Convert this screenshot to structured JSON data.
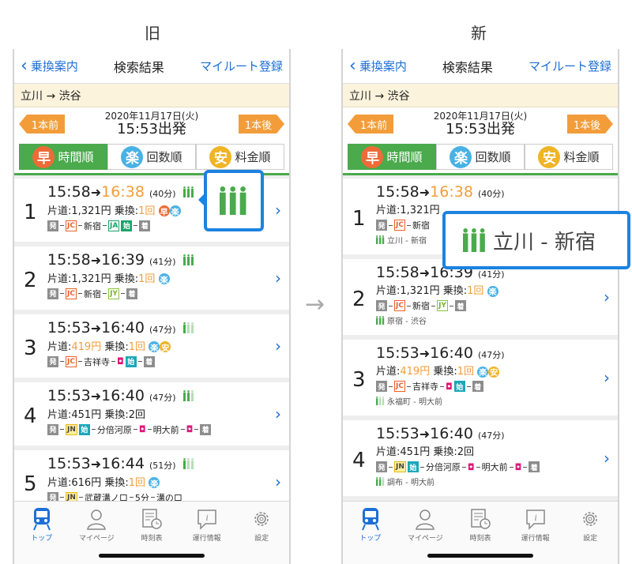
{
  "labels": {
    "old": "旧",
    "new": "新"
  },
  "nav": {
    "back": "乗換案内",
    "title": "検索結果",
    "right": "マイルート登録"
  },
  "route": "立川 → 渋谷",
  "date": {
    "prev": "1本前",
    "next": "1本後",
    "day": "2020年11月17日(火)",
    "dep": "15:53出発"
  },
  "sort": {
    "haya_badge": "早",
    "haya": "時間順",
    "raku_badge": "楽",
    "raku": "回数順",
    "yasu_badge": "安",
    "yasu": "料金順"
  },
  "common": {
    "start": "発",
    "end": "着",
    "jc": "JC",
    "ja": "JA",
    "jy": "JY",
    "jn": "JN",
    "hajime": "始",
    "raku": "楽",
    "yasu": "安",
    "haya": "早",
    "arrow": "➜",
    "fare_label": "片道:",
    "transfer_label": "乗換:",
    "kai": "回"
  },
  "old_results": [
    {
      "num": "1",
      "dep": "15:58",
      "arr": "16:38",
      "arr_late": true,
      "dur": "(40分)",
      "fare": "1,321円",
      "transfers": "1",
      "fare_orange": false,
      "transfers_orange": true,
      "stations": {
        "s1": "新宿"
      }
    },
    {
      "num": "2",
      "dep": "15:58",
      "arr": "16:39",
      "arr_late": false,
      "dur": "(41分)",
      "fare": "1,321円",
      "transfers": "1",
      "fare_orange": false,
      "transfers_orange": true,
      "stations": {
        "s1": "新宿"
      }
    },
    {
      "num": "3",
      "dep": "15:53",
      "arr": "16:40",
      "arr_late": false,
      "dur": "(47分)",
      "fare": "419円",
      "transfers": "1",
      "fare_orange": true,
      "transfers_orange": true,
      "stations": {
        "s1": "吉祥寺"
      }
    },
    {
      "num": "4",
      "dep": "15:53",
      "arr": "16:40",
      "arr_late": false,
      "dur": "(47分)",
      "fare": "451円",
      "transfers": "2",
      "fare_orange": false,
      "transfers_orange": false,
      "stations": {
        "s1": "分倍河原",
        "s2": "明大前"
      }
    },
    {
      "num": "5",
      "dep": "15:53",
      "arr": "16:44",
      "arr_late": false,
      "dur": "(51分)",
      "fare": "616円",
      "transfers": "1",
      "fare_orange": false,
      "transfers_orange": true,
      "stations": {
        "s1": "武蔵溝ノ口",
        "s2": "5分",
        "s3": "溝の口"
      }
    }
  ],
  "new_results": [
    {
      "num": "1",
      "dep": "15:58",
      "arr": "16:38",
      "arr_late": true,
      "dur": "(40分)",
      "fare": "1,321円",
      "stations": {
        "s1": "新宿"
      },
      "sub": "立川 - 新宿"
    },
    {
      "num": "2",
      "dep": "15:58",
      "arr": "16:39",
      "arr_late": false,
      "dur": "(41分)",
      "fare": "1,321円",
      "transfers": "1",
      "stations": {
        "s1": "新宿"
      },
      "sub": "原宿 - 渋谷"
    },
    {
      "num": "3",
      "dep": "15:53",
      "arr": "16:40",
      "arr_late": false,
      "dur": "(47分)",
      "fare": "419円",
      "transfers": "1",
      "stations": {
        "s1": "吉祥寺"
      },
      "sub": "永福町 - 明大前"
    },
    {
      "num": "4",
      "dep": "15:53",
      "arr": "16:40",
      "arr_late": false,
      "dur": "(47分)",
      "fare": "451円",
      "transfers": "2",
      "stations": {
        "s1": "分倍河原",
        "s2": "明大前"
      },
      "sub": "調布 - 明大前"
    }
  ],
  "new_callout": "立川 - 新宿",
  "tabbar": {
    "top": "トップ",
    "mypage": "マイページ",
    "timetable": "時刻表",
    "info": "運行情報",
    "settings": "設定"
  },
  "colors": {
    "accent": "#1d6fd6",
    "green": "#4aaa4c",
    "orange": "#f29d3a",
    "callout": "#1d82e0"
  },
  "icons": [
    "chevron-left-icon",
    "train-seat-icon",
    "train-front-icon",
    "person-icon",
    "timetable-icon",
    "info-icon",
    "gear-icon"
  ]
}
